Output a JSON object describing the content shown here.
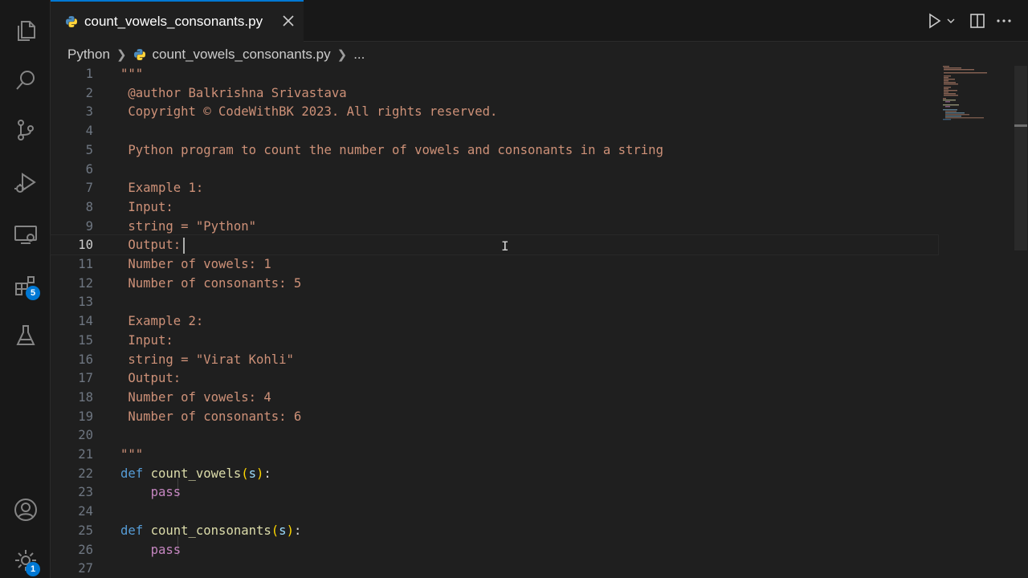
{
  "tab": {
    "filename": "count_vowels_consonants.py"
  },
  "breadcrumb": {
    "root": "Python",
    "file": "count_vowels_consonants.py",
    "more": "..."
  },
  "activity": {
    "extensions_badge": "5",
    "settings_badge": "1"
  },
  "editor": {
    "current_line": 10,
    "lines": [
      {
        "n": "1",
        "tokens": [
          {
            "c": "s",
            "t": "\"\"\""
          }
        ]
      },
      {
        "n": "2",
        "tokens": [
          {
            "c": "s",
            "t": " @author Balkrishna Srivastava"
          }
        ]
      },
      {
        "n": "3",
        "tokens": [
          {
            "c": "s",
            "t": " Copyright © CodeWithBK 2023. All rights reserved."
          }
        ]
      },
      {
        "n": "4",
        "tokens": []
      },
      {
        "n": "5",
        "tokens": [
          {
            "c": "s",
            "t": " Python program to count the number of vowels and consonants in a string"
          }
        ]
      },
      {
        "n": "6",
        "tokens": []
      },
      {
        "n": "7",
        "tokens": [
          {
            "c": "s",
            "t": " Example 1:"
          }
        ]
      },
      {
        "n": "8",
        "tokens": [
          {
            "c": "s",
            "t": " Input:"
          }
        ]
      },
      {
        "n": "9",
        "tokens": [
          {
            "c": "s",
            "t": " string = \"Python\""
          }
        ]
      },
      {
        "n": "10",
        "tokens": [
          {
            "c": "s",
            "t": " Output:"
          }
        ]
      },
      {
        "n": "11",
        "tokens": [
          {
            "c": "s",
            "t": " Number of vowels: 1"
          }
        ]
      },
      {
        "n": "12",
        "tokens": [
          {
            "c": "s",
            "t": " Number of consonants: 5"
          }
        ]
      },
      {
        "n": "13",
        "tokens": []
      },
      {
        "n": "14",
        "tokens": [
          {
            "c": "s",
            "t": " Example 2:"
          }
        ]
      },
      {
        "n": "15",
        "tokens": [
          {
            "c": "s",
            "t": " Input:"
          }
        ]
      },
      {
        "n": "16",
        "tokens": [
          {
            "c": "s",
            "t": " string = \"Virat Kohli\""
          }
        ]
      },
      {
        "n": "17",
        "tokens": [
          {
            "c": "s",
            "t": " Output:"
          }
        ]
      },
      {
        "n": "18",
        "tokens": [
          {
            "c": "s",
            "t": " Number of vowels: 4"
          }
        ]
      },
      {
        "n": "19",
        "tokens": [
          {
            "c": "s",
            "t": " Number of consonants: 6"
          }
        ]
      },
      {
        "n": "20",
        "tokens": []
      },
      {
        "n": "21",
        "tokens": [
          {
            "c": "s",
            "t": "\"\"\""
          }
        ]
      },
      {
        "n": "22",
        "tokens": [
          {
            "c": "k",
            "t": "def"
          },
          {
            "c": "punc",
            "t": " "
          },
          {
            "c": "f",
            "t": "count_vowels"
          },
          {
            "c": "bracket",
            "t": "("
          },
          {
            "c": "p",
            "t": "s"
          },
          {
            "c": "bracket",
            "t": ")"
          },
          {
            "c": "punc",
            "t": ":"
          }
        ]
      },
      {
        "n": "23",
        "tokens": [
          {
            "c": "punc",
            "t": "    "
          },
          {
            "c": "ctl",
            "t": "pass"
          }
        ]
      },
      {
        "n": "24",
        "tokens": []
      },
      {
        "n": "25",
        "tokens": [
          {
            "c": "k",
            "t": "def"
          },
          {
            "c": "punc",
            "t": " "
          },
          {
            "c": "f",
            "t": "count_consonants"
          },
          {
            "c": "bracket",
            "t": "("
          },
          {
            "c": "p",
            "t": "s"
          },
          {
            "c": "bracket",
            "t": ")"
          },
          {
            "c": "punc",
            "t": ":"
          }
        ]
      },
      {
        "n": "26",
        "tokens": [
          {
            "c": "punc",
            "t": "    "
          },
          {
            "c": "ctl",
            "t": "pass"
          }
        ]
      },
      {
        "n": "27",
        "tokens": []
      }
    ]
  }
}
